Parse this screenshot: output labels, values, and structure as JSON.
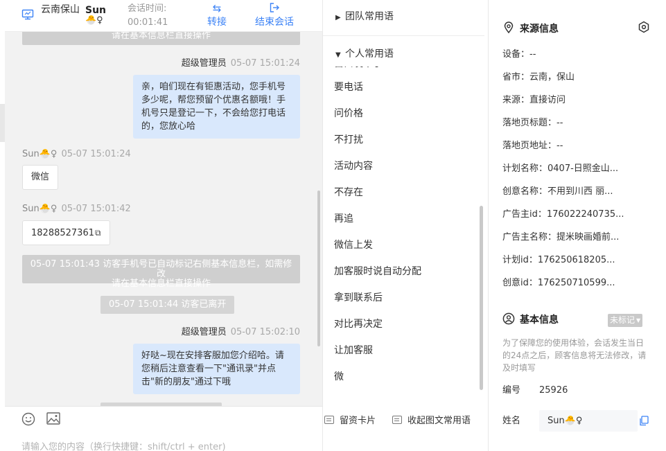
{
  "header": {
    "location": "云南保山",
    "visitor_name": "Sun",
    "visitor_emoji": "🐣♀",
    "session_time_label": "会话时间:",
    "session_time_value": "00:01:41",
    "transfer_label": "转接",
    "end_label": "结束会话",
    "accent_color": "#3b82f6"
  },
  "chat": {
    "messages": [
      {
        "kind": "system",
        "text": "请在基本信息栏直接操作"
      },
      {
        "kind": "agent",
        "sender": "超级管理员",
        "time": "05-07 15:01:24",
        "text": "亲，咱们现在有钜惠活动，您手机号多少呢，帮您预留个优惠名额哦！手机号只是登记一下，不会给您打电话的，您放心哈"
      },
      {
        "kind": "user",
        "sender": "Sun🐣♀",
        "time": "05-07 15:01:24",
        "text": "微信"
      },
      {
        "kind": "user",
        "sender": "Sun🐣♀",
        "time": "05-07 15:01:42",
        "text": "18288527361"
      },
      {
        "kind": "system",
        "text_line1": "05-07 15:01:43 访客手机号已自动标记右侧基本信息栏，如需修改",
        "text_line2": "请在基本信息栏直接操作"
      },
      {
        "kind": "system_pill",
        "text": "05-07 15:01:44 访客已离开"
      },
      {
        "kind": "agent",
        "sender": "超级管理员",
        "time": "05-07 15:02:10",
        "text": "好哒~现在安排客服加您介绍哈。请您稍后注意查看一下\"通讯录\"并点击\"新的朋友\"通过下哦"
      }
    ]
  },
  "input": {
    "placeholder": "请输入您的内容（换行快捷键：shift/ctrl + enter)",
    "emoji_icon": "smile-icon",
    "image_icon": "image-icon"
  },
  "quick_replies": {
    "team_group": "团队常用语",
    "personal_group": "个人常用语",
    "items": [
      "要电话",
      "问价格",
      "不打扰",
      "活动内容",
      "不存在",
      "再追",
      "微信上发",
      "加客服时说自动分配",
      "拿到联系后",
      "对比再决定",
      "让加客服",
      "微"
    ],
    "card_label": "留资卡片",
    "collect_label": "收起图文常用语"
  },
  "source_info": {
    "title": "来源信息",
    "rows": [
      "设备：--",
      "省市：云南，保山",
      "来源：直接访问",
      "落地页标题：--",
      "落地页地址：--",
      "计划名称：0407-日照金山...",
      "创意名称：不用到川西 丽...",
      "广告主id：176022240735...",
      "广告主名称：提米映画婚前...",
      "计划id：176250618205...",
      "创意id：176250710599..."
    ]
  },
  "basic_info": {
    "title": "基本信息",
    "badge": "未标记",
    "notice": "为了保障您的使用体验，会话发生当日的24点之后，顾客信息将无法修改，请及时填写",
    "number_label": "编号",
    "number_value": "25926",
    "name_label": "姓名",
    "name_value": "Sun🐣♀"
  }
}
